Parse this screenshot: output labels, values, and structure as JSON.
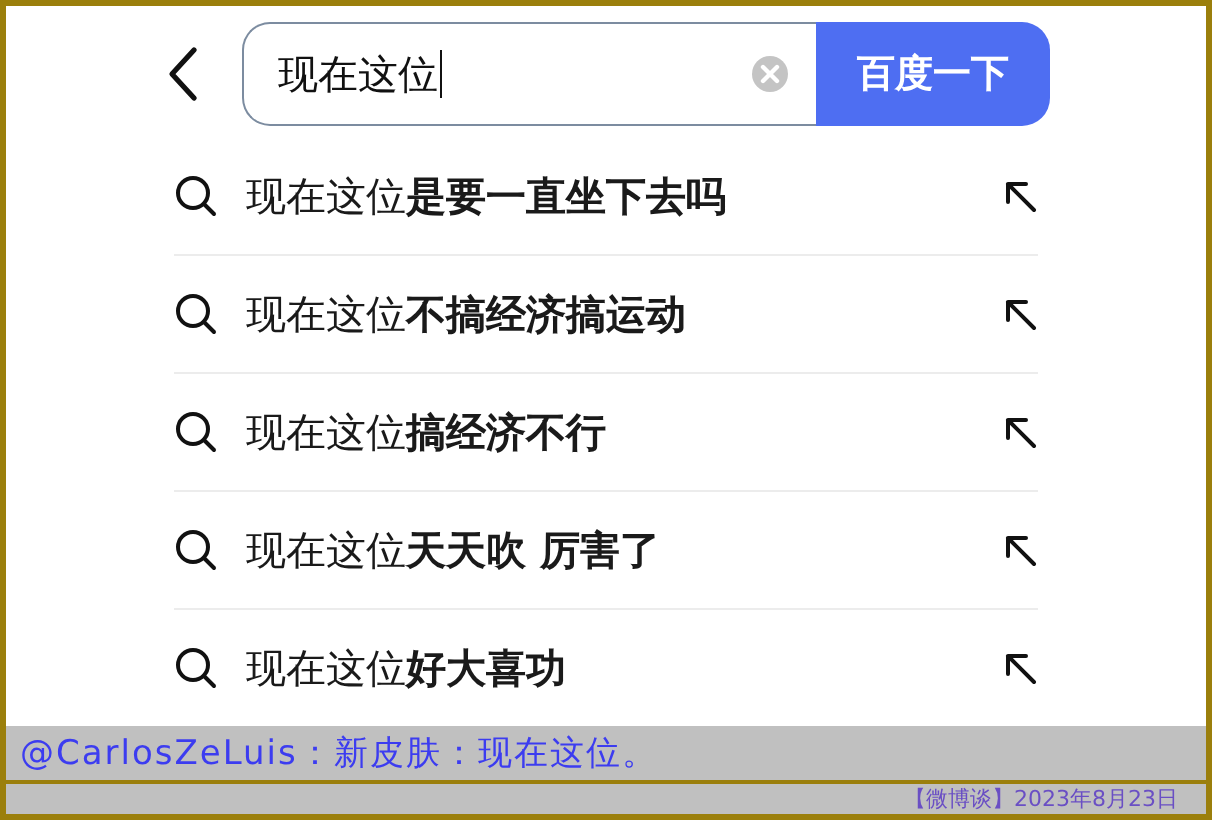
{
  "search_bar": {
    "value": "现在这位",
    "button": "百度一下"
  },
  "suggestions": [
    {
      "text": "现在这位**是要一直坐下去吗**"
    },
    {
      "text": "现在这位**不搞经济搞运动**"
    },
    {
      "text": "现在这位**搞经济不行**"
    },
    {
      "text": "现在这位**天天吹 厉害了**"
    },
    {
      "text": "现在这位**好大喜功**"
    }
  ],
  "caption": {
    "text": "@CarlosZeLuis：新皮肤：现在这位。",
    "source": "【微博谈】2023年8月23日"
  }
}
